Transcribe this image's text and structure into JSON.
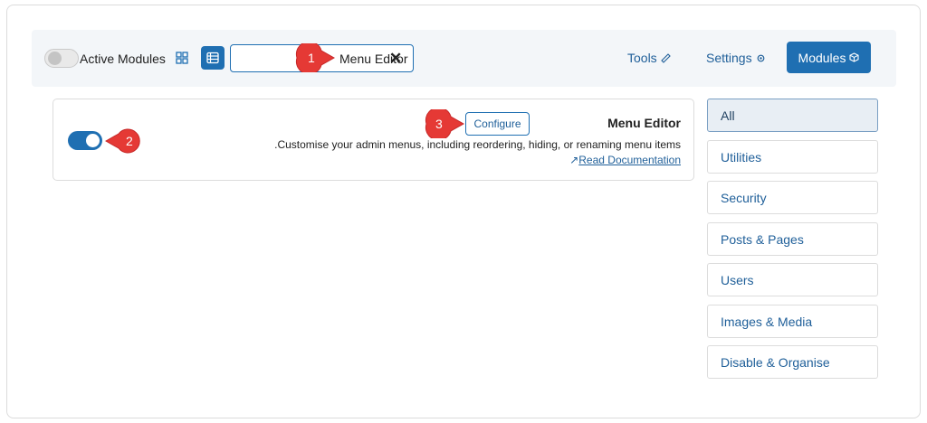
{
  "toolbar": {
    "active_modules_label": "Active Modules",
    "search_value": "Menu Editor",
    "tools_label": "Tools",
    "settings_label": "Settings",
    "modules_label": "Modules"
  },
  "module_card": {
    "title": "Menu Editor",
    "configure_label": "Configure",
    "description": ".Customise your admin menus, including reordering, hiding, or renaming menu items",
    "doc_link": "Read Documentation",
    "enabled": true
  },
  "categories": [
    {
      "label": "All",
      "active": true
    },
    {
      "label": "Utilities"
    },
    {
      "label": "Security"
    },
    {
      "label": "Posts & Pages"
    },
    {
      "label": "Users"
    },
    {
      "label": "Images & Media"
    },
    {
      "label": "Disable & Organise"
    }
  ],
  "callouts": [
    "1",
    "2",
    "3"
  ],
  "colors": {
    "accent": "#1f6fb2",
    "callout": "#e53935"
  },
  "icons": [
    "grid-icon",
    "list-icon",
    "close-icon",
    "wrench-icon",
    "gear-icon",
    "cube-icon",
    "external-link-icon",
    "callout-arrow-icon"
  ]
}
